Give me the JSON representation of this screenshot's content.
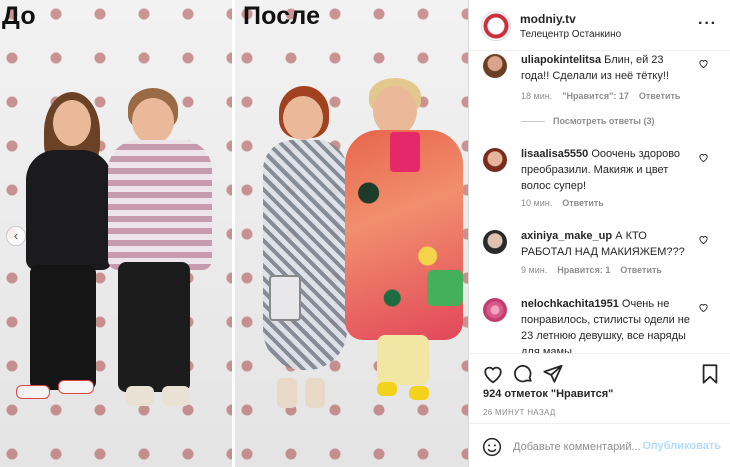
{
  "photo": {
    "before_label": "До",
    "after_label": "После"
  },
  "header": {
    "username": "modniy.tv",
    "location": "Телецентр Останкино"
  },
  "comments": [
    {
      "username": "uliapokintelitsa",
      "text": "Блин, ей 23 года!! Сделали из неё тётку!!",
      "time": "18 мин.",
      "likes": "\"Нравится\": 17",
      "reply": "Ответить",
      "view_replies": "Посмотреть ответы (3)"
    },
    {
      "username": "lisaalisa5550",
      "text": "Ооочень здорово преобразили. Макияж и цвет волос супер!",
      "time": "10 мин.",
      "reply": "Ответить"
    },
    {
      "username": "axiniya_make_up",
      "text": "А КТО РАБОТАЛ НАД МАКИЯЖЕМ???",
      "time": "9 мин.",
      "likes": "Нравится: 1",
      "reply": "Ответить"
    },
    {
      "username": "nelochkachita1951",
      "text": "Очень не понравилось, стилисты одели не 23 летнюю девушку, все наряды для мамы ."
    }
  ],
  "post": {
    "likes": "924 отметок \"Нравится\"",
    "time": "26 МИНУТ НАЗАД"
  },
  "add_comment": {
    "placeholder": "Добавьте комментарий...",
    "publish": "Опубликовать"
  },
  "colors": {
    "accent": "#0095f6",
    "publish_disabled": "#b3dbff",
    "meta": "#8e8e8e"
  },
  "icons": [
    "heart-icon",
    "comment-icon",
    "share-icon",
    "bookmark-icon",
    "emoji-icon",
    "more-icon",
    "chevron-left-icon"
  ]
}
